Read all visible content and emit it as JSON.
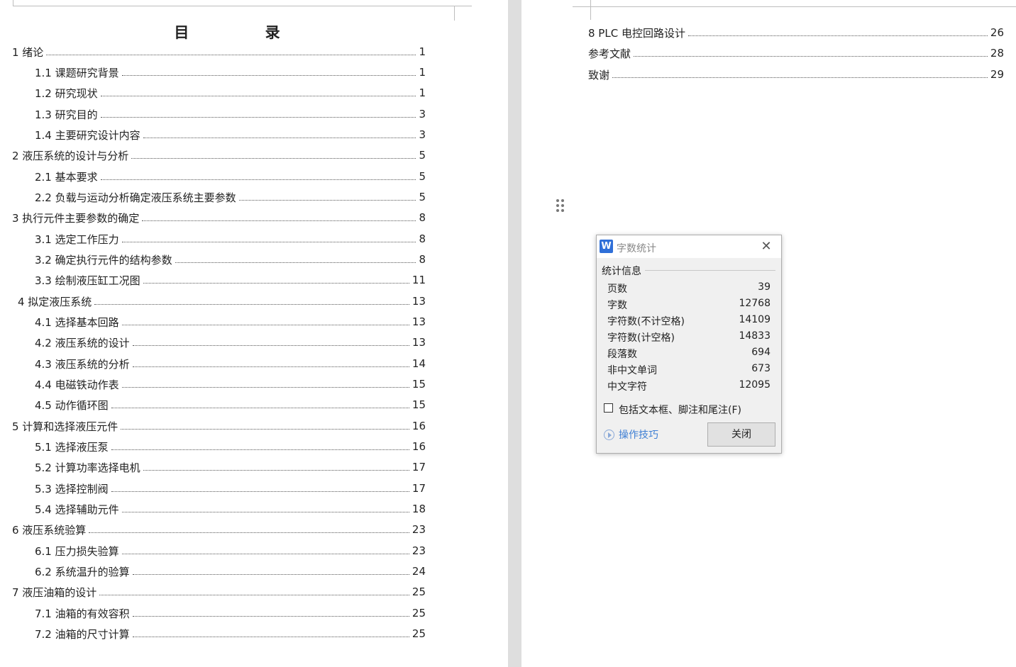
{
  "left_page": {
    "title": "目 录",
    "entries": [
      {
        "label": "1 绪论",
        "page": "1"
      },
      {
        "label": "1.1 课题研究背景",
        "page": "1"
      },
      {
        "label": "1.2 研究现状",
        "page": "1"
      },
      {
        "label": "1.3 研究目的",
        "page": "3"
      },
      {
        "label": "1.4 主要研究设计内容",
        "page": "3"
      },
      {
        "label": "2 液压系统的设计与分析",
        "page": "5"
      },
      {
        "label": "2.1 基本要求",
        "page": "5"
      },
      {
        "label": "2.2 负载与运动分析确定液压系统主要参数",
        "page": "5"
      },
      {
        "label": "3 执行元件主要参数的确定",
        "page": "8"
      },
      {
        "label": "3.1 选定工作压力",
        "page": "8"
      },
      {
        "label": "3.2 确定执行元件的结构参数",
        "page": "8"
      },
      {
        "label": "3.3 绘制液压缸工况图",
        "page": "11"
      },
      {
        "label": "4 拟定液压系统",
        "page": "13"
      },
      {
        "label": "4.1 选择基本回路",
        "page": "13"
      },
      {
        "label": "4.2 液压系统的设计",
        "page": "13"
      },
      {
        "label": "4.3 液压系统的分析",
        "page": "14"
      },
      {
        "label": "4.4 电磁铁动作表",
        "page": "15"
      },
      {
        "label": "4.5 动作循环图",
        "page": "15"
      },
      {
        "label": "5 计算和选择液压元件",
        "page": "16"
      },
      {
        "label": "5.1 选择液压泵",
        "page": "16"
      },
      {
        "label": "5.2 计算功率选择电机",
        "page": "17"
      },
      {
        "label": "5.3 选择控制阀",
        "page": "17"
      },
      {
        "label": "5.4 选择辅助元件",
        "page": "18"
      },
      {
        "label": "6 液压系统验算",
        "page": "23"
      },
      {
        "label": "6.1 压力损失验算",
        "page": "23"
      },
      {
        "label": "6.2 系统温升的验算",
        "page": "24"
      },
      {
        "label": "7 液压油箱的设计",
        "page": "25"
      },
      {
        "label": "7.1 油箱的有效容积",
        "page": "25"
      },
      {
        "label": "7.2 油箱的尺寸计算",
        "page": "25"
      }
    ]
  },
  "right_page": {
    "entries": [
      {
        "label": "8 PLC 电控回路设计",
        "page": "26"
      },
      {
        "label": "参考文献",
        "page": "28"
      },
      {
        "label": "致谢",
        "page": "29"
      }
    ]
  },
  "dialog": {
    "title": "字数统计",
    "close_glyph": "✕",
    "group_label": "统计信息",
    "stats": [
      {
        "key": "页数",
        "value": "39"
      },
      {
        "key": "字数",
        "value": "12768"
      },
      {
        "key": "字符数(不计空格)",
        "value": "14109"
      },
      {
        "key": "字符数(计空格)",
        "value": "14833"
      },
      {
        "key": "段落数",
        "value": "694"
      },
      {
        "key": "非中文单词",
        "value": "673"
      },
      {
        "key": "中文字符",
        "value": "12095"
      }
    ],
    "checkbox_label": "包括文本框、脚注和尾注(F)",
    "checkbox_checked": false,
    "tips_label": "操作技巧",
    "close_button_label": "关闭",
    "logo_letter": "W"
  }
}
